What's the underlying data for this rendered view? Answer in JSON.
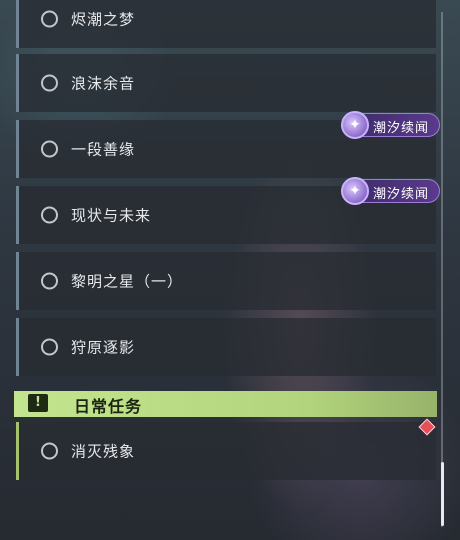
{
  "quests": [
    {
      "label": "烬潮之梦"
    },
    {
      "label": "浪沫余音"
    },
    {
      "label": "一段善缘"
    },
    {
      "label": "现状与未来"
    },
    {
      "label": "黎明之星（一）"
    },
    {
      "label": "狩原逐影"
    }
  ],
  "badges": [
    {
      "text": "潮汐续闻",
      "icon": "tide-sigil-icon"
    },
    {
      "text": "潮汐续闻",
      "icon": "tide-sigil-icon"
    }
  ],
  "daily_section": {
    "title": "日常任务",
    "icon": "exclamation-icon",
    "accent": "#c3e58e"
  },
  "daily_quests": [
    {
      "label": "消灭残象"
    }
  ],
  "colors": {
    "panel_border": "#6f8594",
    "badge_purple": "#5a3a8c",
    "marker_red": "#e3505a"
  }
}
